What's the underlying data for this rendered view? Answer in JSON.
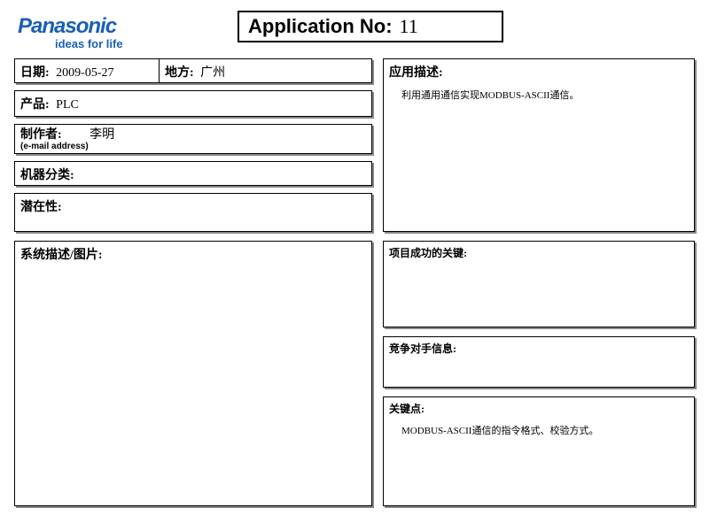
{
  "logo": {
    "main": "Panasonic",
    "sub": "ideas for life"
  },
  "appNo": {
    "label": "Application No:",
    "value": "11"
  },
  "date": {
    "label": "日期:",
    "value": "2009-05-27"
  },
  "place": {
    "label": "地方:",
    "value": "广州"
  },
  "product": {
    "label": "产品:",
    "value": "PLC"
  },
  "author": {
    "label": "制作者:",
    "value": "李明",
    "emailLabel": "(e-mail address)"
  },
  "machineCategory": {
    "label": "机器分类:"
  },
  "potential": {
    "label": "潜在性:"
  },
  "sysDesc": {
    "label": "系统描述/图片:"
  },
  "appDesc": {
    "label": "应用描述:",
    "body": "利用通用通信实现MODBUS-ASCII通信。"
  },
  "projSuccess": {
    "label": "项目成功的关键:"
  },
  "competitor": {
    "label": "竞争对手信息:"
  },
  "keypoint": {
    "label": "关键点:",
    "body": "MODBUS-ASCII通信的指令格式、校验方式。"
  }
}
